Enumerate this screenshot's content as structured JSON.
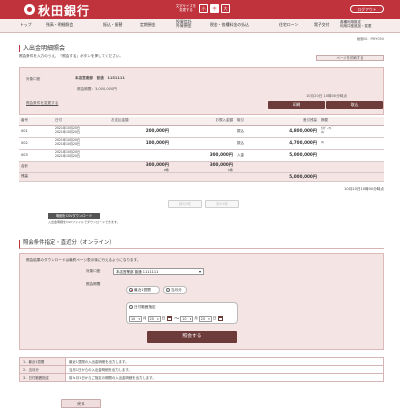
{
  "header": {
    "bank_name": "秋田銀行",
    "font_size_label": "文字サイズを変更する",
    "font_sizes": [
      "小",
      "中",
      "大"
    ],
    "logout": "ログアウト"
  },
  "nav": {
    "items": [
      "トップ",
      "残高・明細照会",
      "振込・振替",
      "定期預金",
      "投資信託\n外貨預金",
      "税金・各種料金の払込",
      "住宅ローン",
      "電子交付",
      "各種利用設定\n利用口座追加・変更"
    ]
  },
  "ref_number": "画面ID：PMY050",
  "page": {
    "title": "入出金明細照会",
    "instruction": "照会条件を入力のうえ、「照会する」ボタンを押してください。",
    "help_link": "ページを印刷する"
  },
  "account": {
    "label": "対象口座",
    "value": "本店営業部　普通　1151111",
    "period": "照会期間：3,000,000円",
    "updated": "10月20日 10時00分時点",
    "change_link": "照会条件を変更する",
    "print_btn": "印刷",
    "download_btn": "取込"
  },
  "table": {
    "headers": [
      "番号",
      "日付",
      "お支払金額",
      "お預入金額",
      "取引",
      "差引残高",
      "摘要"
    ],
    "rows": [
      {
        "no": "001",
        "dates": "2021年10月20日\n2021年10月20日",
        "withdraw": "200,000円",
        "deposit": "",
        "type": "振込",
        "balance": "4,800,000円",
        "memo": "ｶ)ﾋﾞｰｱﾄﾞ\nﾏﾙ"
      },
      {
        "no": "002",
        "dates": "2021年10月20日\n2021年10月20日",
        "withdraw": "100,000円",
        "deposit": "",
        "type": "振込",
        "balance": "4,700,000円",
        "memo": "ﾏﾙ"
      },
      {
        "no": "003",
        "dates": "2021年10月20日\n2021年10月20日",
        "withdraw": "",
        "deposit": "300,000円",
        "type": "入金",
        "balance": "5,000,000円",
        "memo": ""
      }
    ],
    "total_label": "合計",
    "total_withdraw": "300,000円",
    "total_withdraw_count": "2件",
    "total_deposit": "300,000円",
    "total_deposit_count": "1件",
    "balance_label": "残高",
    "balance_value": "5,000,000円"
  },
  "final_date": "10月20日10時00分時点",
  "paging": {
    "prev": "前の5件",
    "next": "次の5件"
  },
  "csv": {
    "button": "明細をCSVダウンロード",
    "note": "入出金明細をCSVファイルでダウンロードできます。"
  },
  "section_title": "照会条件指定・直近分（オンライン）",
  "form": {
    "desc": "照会結果のダウンロードは最終ページ表示後に行えるようになります。",
    "account_label": "対象口座",
    "account_value": "本店営業部 普通 1111111",
    "period_label": "照会期間",
    "opt_recent": "最近1週間",
    "opt_month": "当月分",
    "opt_range": "日付範囲指定",
    "from_month": "10",
    "from_day": "20",
    "to_month": "10",
    "to_day": "20",
    "unit_month": "月",
    "unit_day": "日",
    "tilde": "〜",
    "search_btn": "照会する"
  },
  "help": [
    {
      "k": "1．最近1週間",
      "v": "最近1週間の入出金明細を出力します。"
    },
    {
      "k": "2．当月分",
      "v": "当月1日からの入出金明細を出力します。"
    },
    {
      "k": "3．日付範囲指定",
      "v": "前々月1日からご指定の期間の入出金明細を出力します。"
    }
  ],
  "back_btn": "戻る",
  "colors": {
    "brand": "#c0323c",
    "panel": "#f5e4e4",
    "button": "#6e3b3b"
  }
}
